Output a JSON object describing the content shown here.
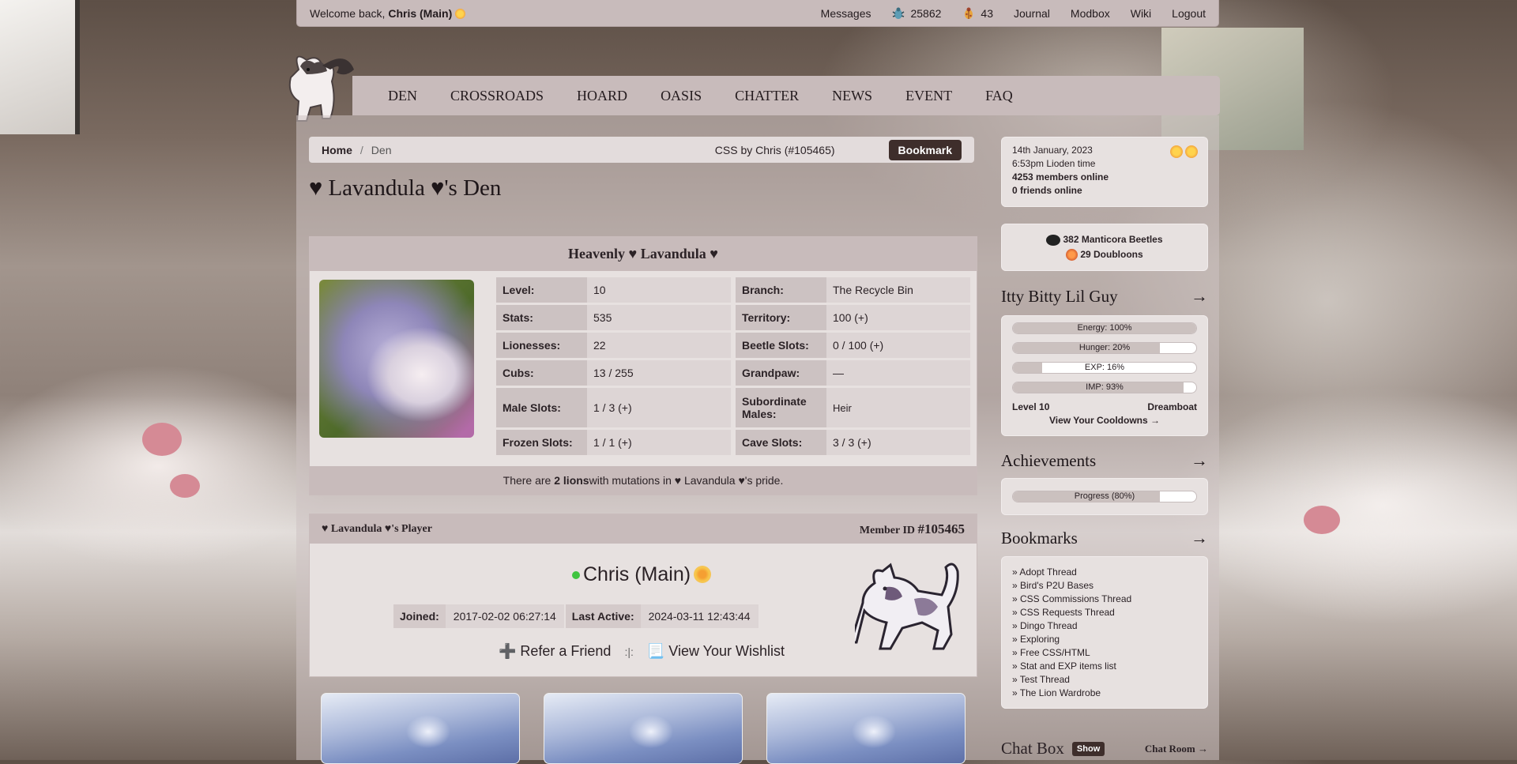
{
  "topbar": {
    "welcome_prefix": "Welcome back, ",
    "username": "Chris (Main)",
    "messages": "Messages",
    "beetles": "25862",
    "bugs": "43",
    "journal": "Journal",
    "modbox": "Modbox",
    "wiki": "Wiki",
    "logout": "Logout"
  },
  "nav": {
    "items": [
      "DEN",
      "CROSSROADS",
      "HOARD",
      "OASIS",
      "CHATTER",
      "NEWS",
      "EVENT",
      "FAQ"
    ]
  },
  "breadcrumb": {
    "home": "Home",
    "sep": "/",
    "current": "Den",
    "css_credit": "CSS by Chris (#105465)",
    "bookmark": "Bookmark"
  },
  "page_title": "♥ Lavandula ♥'s Den",
  "pride": {
    "heading": "Heavenly ♥ Lavandula ♥",
    "stats": [
      {
        "k": "Level:",
        "v": "10"
      },
      {
        "k": "Branch:",
        "v": "The Recycle Bin"
      },
      {
        "k": "Stats:",
        "v": "535"
      },
      {
        "k": "Territory:",
        "v": "100 (+)"
      },
      {
        "k": "Lionesses:",
        "v": "22"
      },
      {
        "k": "Beetle Slots:",
        "v": "0 / 100 (+)"
      },
      {
        "k": "Cubs:",
        "v": "13 / 255"
      },
      {
        "k": "Grandpaw:",
        "v": "—"
      },
      {
        "k": "Male Slots:",
        "v": "1 / 3 (+)"
      },
      {
        "k": "Subordinate Males:",
        "v": "Heir"
      },
      {
        "k": "Frozen Slots:",
        "v": "1 / 1 (+)"
      },
      {
        "k": "Cave Slots:",
        "v": "3 / 3 (+)"
      }
    ],
    "footer_pre": "There are ",
    "footer_count": "2 lions",
    "footer_post": " with mutations in ♥ Lavandula ♥'s pride."
  },
  "player": {
    "heading": "♥ Lavandula ♥'s Player",
    "member_label": "Member ID ",
    "member_id": "#105465",
    "name": "Chris (Main)",
    "joined_label": "Joined:",
    "joined": "2017-02-02 06:27:14",
    "active_label": "Last Active:",
    "active": "2024-03-11 12:43:44",
    "refer": "➕ Refer a Friend",
    "sep": ":|:",
    "wishlist": "📃 View Your Wishlist"
  },
  "sidebar": {
    "date": "14th January, 2023",
    "time": "6:53pm Lioden time",
    "members_online": "4253 members online",
    "friends_online": "0 friends online",
    "beetles": "382 Manticora Beetles",
    "doubloons": "29 Doubloons",
    "pet_title": "Itty Bitty Lil Guy",
    "pet_bars": [
      {
        "label": "Energy: 100%",
        "value": 100
      },
      {
        "label": "Hunger: 20%",
        "value": 80
      },
      {
        "label": "EXP: 16%",
        "value": 16
      },
      {
        "label": "IMP: 93%",
        "value": 93
      }
    ],
    "pet_level": "Level 10",
    "pet_type": "Dreamboat",
    "cooldowns": "View Your Cooldowns →",
    "achievements_title": "Achievements",
    "achievements_label": "Progress (80%)",
    "achievements_value": 80,
    "bookmarks_title": "Bookmarks",
    "bookmarks": [
      "Adopt Thread",
      "Bird's P2U Bases",
      "CSS Commissions Thread",
      "CSS Requests Thread",
      "Dingo Thread",
      "Exploring",
      "Free CSS/HTML",
      "Stat and EXP items list",
      "Test Thread",
      "The Lion Wardrobe"
    ],
    "arrow": "→",
    "chat_title": "Chat Box",
    "chat_show": "Show",
    "chat_room": "Chat Room →"
  }
}
